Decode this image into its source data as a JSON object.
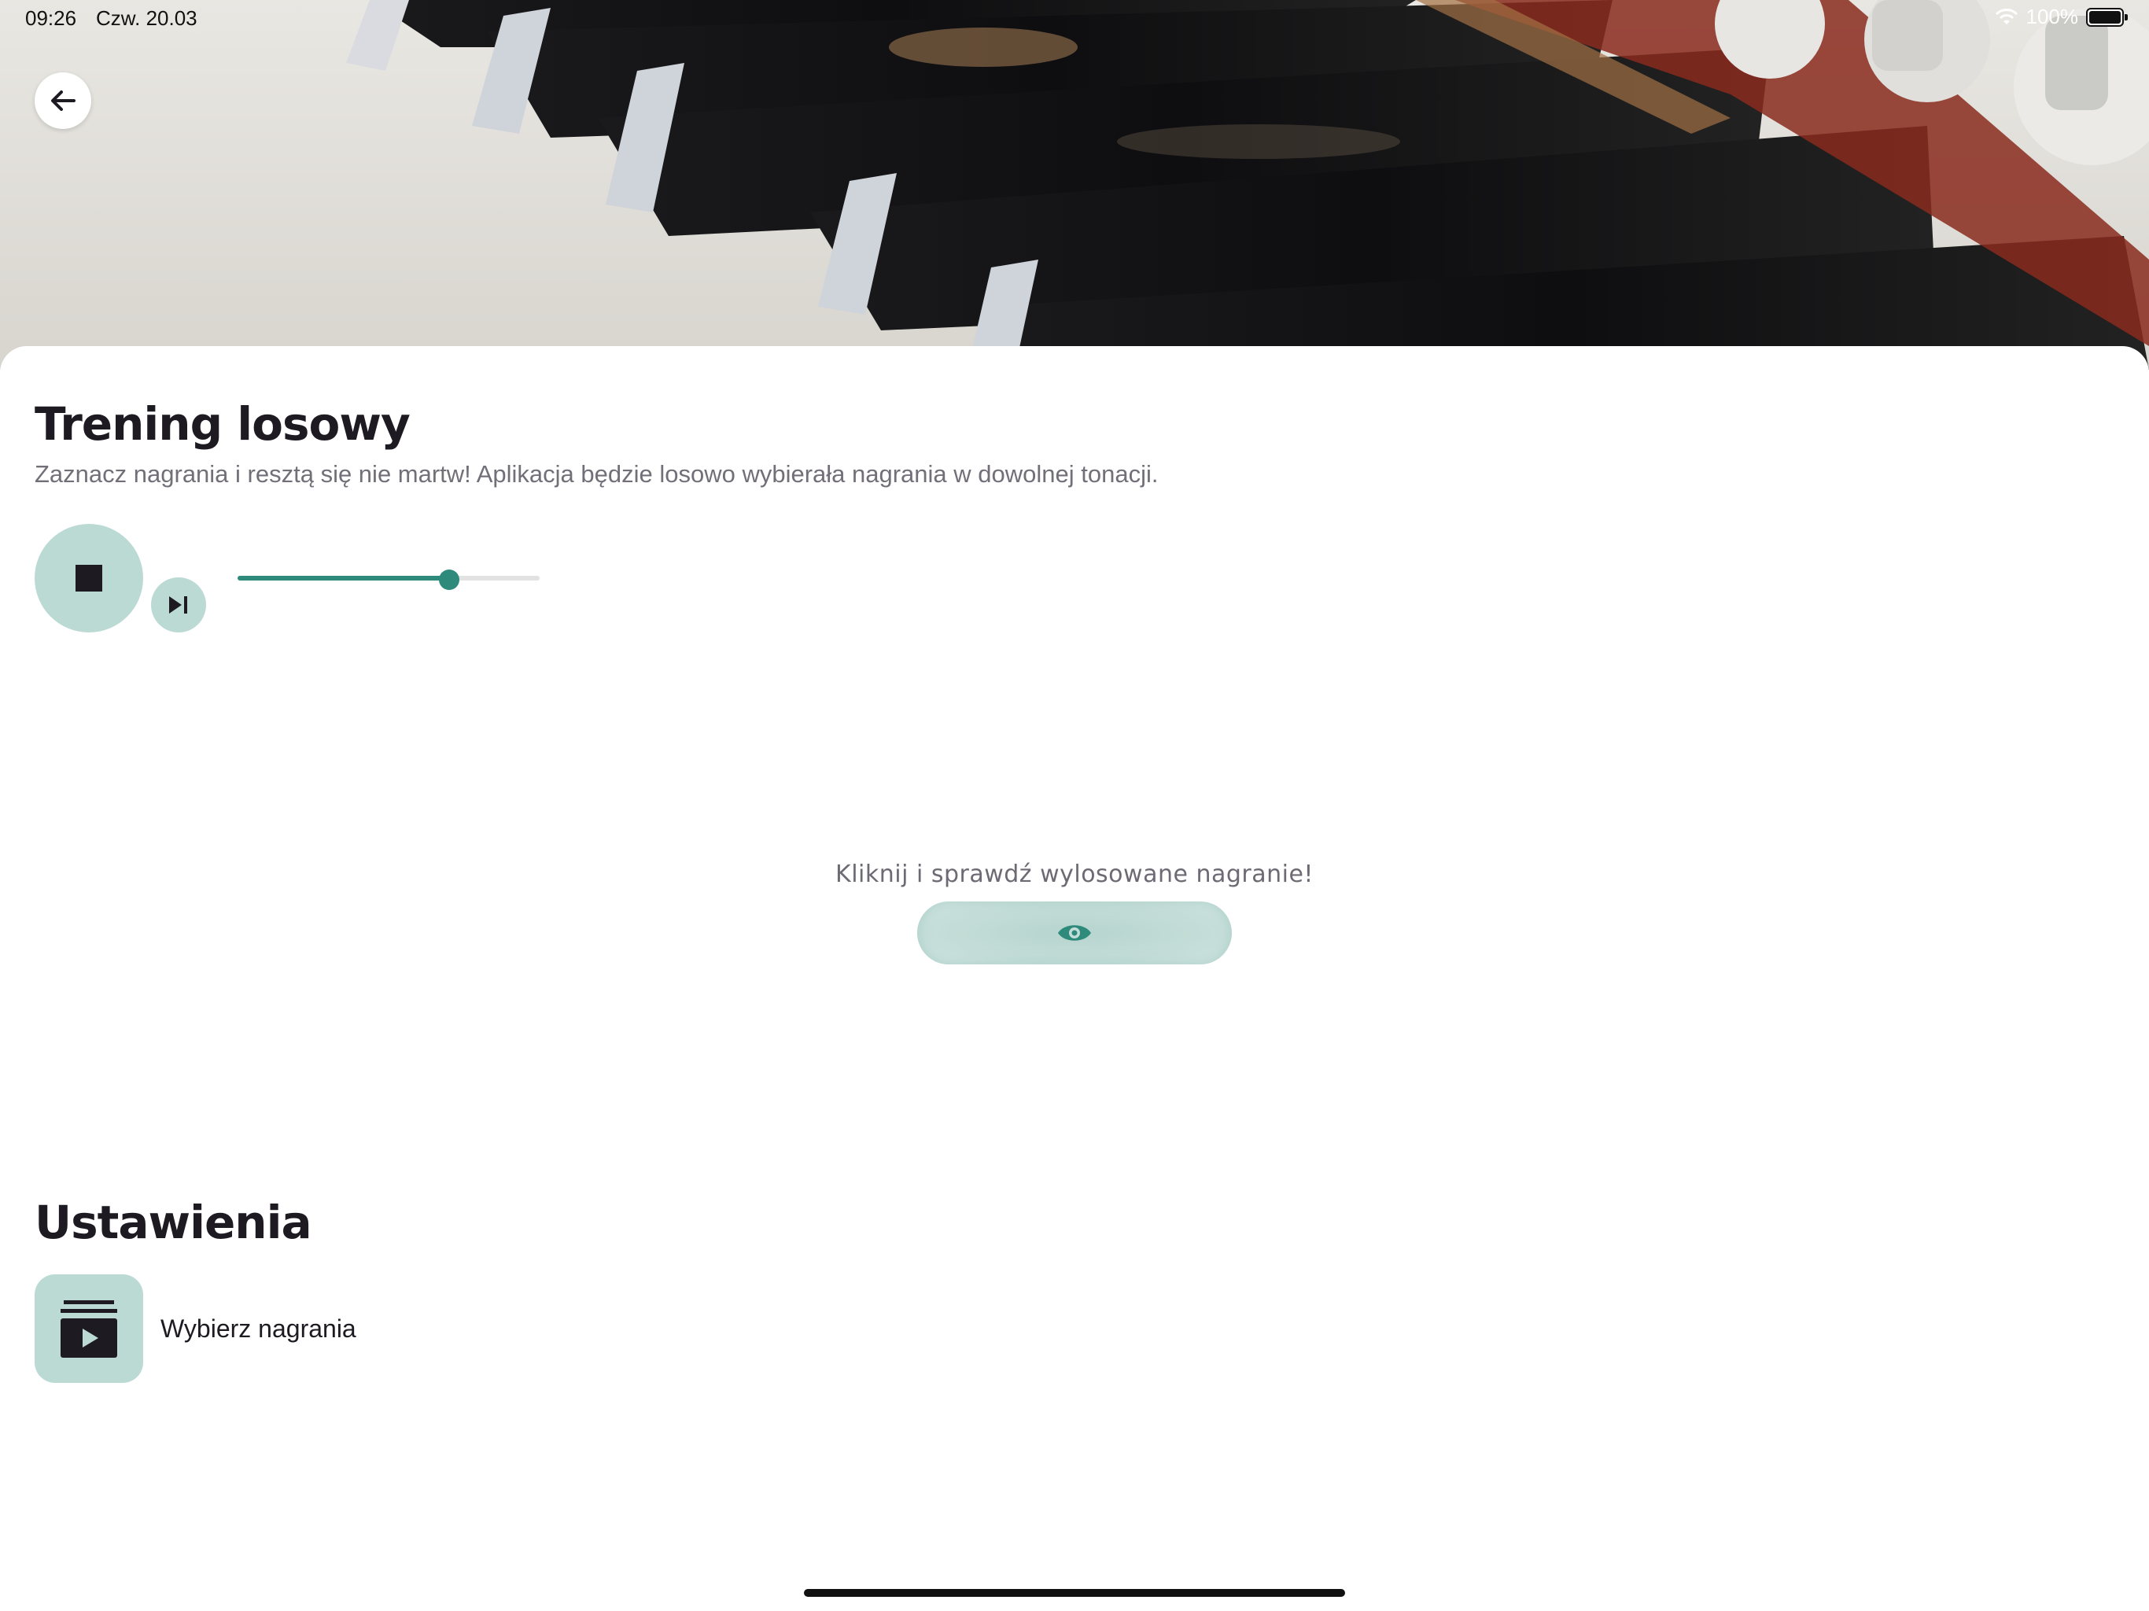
{
  "status_bar": {
    "time": "09:26",
    "date": "Czw. 20.03",
    "battery": "100%",
    "icons": [
      "wifi-icon",
      "battery-icon"
    ]
  },
  "header": {
    "image": "piano-keys-photo",
    "back_icon": "arrow-left-icon"
  },
  "main": {
    "title": "Trening losowy",
    "subtitle": "Zaznacz nagrania i resztą się nie martw! Aplikacja będzie losowo wybierała nagrania w dowolnej tonacji.",
    "player": {
      "stop_icon": "stop-icon",
      "skip_icon": "skip-next-icon",
      "slider_value": 0.7
    },
    "reveal": {
      "label": "Kliknij i sprawdź wylosowane nagranie!",
      "icon": "eye-icon"
    }
  },
  "settings": {
    "title": "Ustawienia",
    "items": [
      {
        "label": "Wybierz nagrania",
        "icon": "video-library-icon"
      }
    ]
  },
  "colors": {
    "accent": "#2e8b7c",
    "accent_light": "#bcdad4",
    "text_dark": "#1d1a22",
    "text_muted": "#726f78"
  }
}
